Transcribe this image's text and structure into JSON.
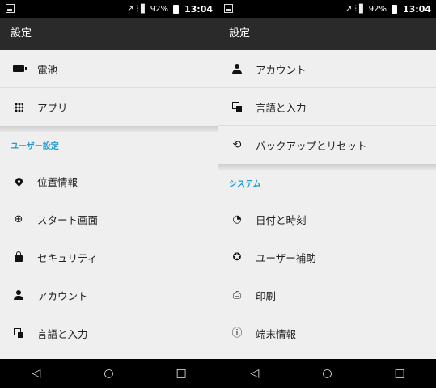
{
  "status": {
    "signal": "↗ ⫶ ▋",
    "battery_pct": "92%",
    "time": "13:04"
  },
  "left": {
    "title": "設定",
    "group1": [
      {
        "label": "電池",
        "icon": "battery-icon"
      },
      {
        "label": "アプリ",
        "icon": "apps-icon"
      }
    ],
    "section": "ユーザー設定",
    "group2": [
      {
        "label": "位置情報",
        "icon": "location-icon"
      },
      {
        "label": "スタート画面",
        "icon": "start-screen-icon"
      },
      {
        "label": "セキュリティ",
        "icon": "lock-icon"
      },
      {
        "label": "アカウント",
        "icon": "account-icon"
      },
      {
        "label": "言語と入力",
        "icon": "language-icon"
      }
    ]
  },
  "right": {
    "title": "設定",
    "group1": [
      {
        "label": "アカウント",
        "icon": "account-icon"
      },
      {
        "label": "言語と入力",
        "icon": "language-icon"
      },
      {
        "label": "バックアップとリセット",
        "icon": "backup-icon"
      }
    ],
    "section": "システム",
    "group2": [
      {
        "label": "日付と時刻",
        "icon": "date-time-icon"
      },
      {
        "label": "ユーザー補助",
        "icon": "accessibility-icon"
      },
      {
        "label": "印刷",
        "icon": "print-icon"
      },
      {
        "label": "端末情報",
        "icon": "info-icon"
      }
    ]
  },
  "nav": {
    "back": "◁",
    "home": "○",
    "recents": "□"
  }
}
